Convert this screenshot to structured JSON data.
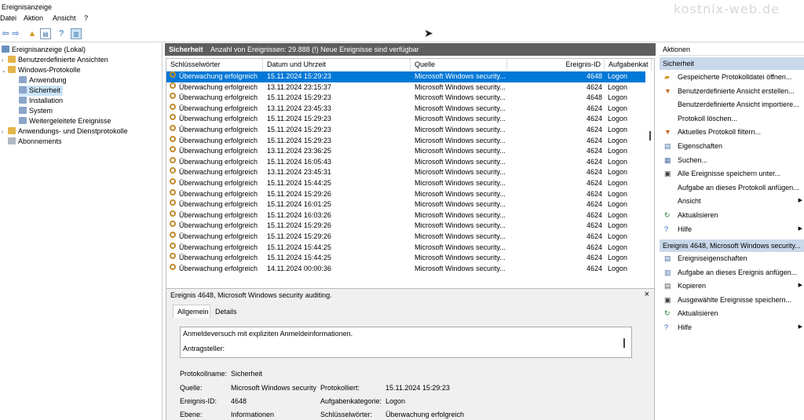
{
  "app": {
    "title": "Ereignisanzeige",
    "watermark": "kostnix-web.de"
  },
  "menu": [
    "Datei",
    "Aktion",
    "Ansicht",
    "?"
  ],
  "tree": {
    "items": [
      {
        "label": "Ereignisanzeige (Lokal)",
        "level": 0
      },
      {
        "label": "Benutzerdefinierte Ansichten",
        "level": 0
      },
      {
        "label": "Windows-Protokolle",
        "level": 0
      },
      {
        "label": "Anwendung",
        "level": 1
      },
      {
        "label": "Sicherheit",
        "level": 1
      },
      {
        "label": "Installation",
        "level": 1
      },
      {
        "label": "System",
        "level": 1
      },
      {
        "label": "Weitergeleitete Ereignisse",
        "level": 1
      },
      {
        "label": "Anwendungs- und Dienstprotokolle",
        "level": 0
      },
      {
        "label": "Abonnements",
        "level": 0
      }
    ]
  },
  "center": {
    "title": "Sicherheit",
    "count": "Anzahl von Ereignissen: 29.888 (!) Neue Ereignisse sind verfügbar"
  },
  "columns": [
    "Schlüsselwörter",
    "Datum und Uhrzeit",
    "Quelle",
    "Ereignis-ID",
    "Aufgabenkat"
  ],
  "rows": [
    [
      "Überwachung erfolgreich",
      "15.11.2024 15:29:23",
      "Microsoft Windows security...",
      "4648",
      "Logon"
    ],
    [
      "Überwachung erfolgreich",
      "13.11.2024 23:15:37",
      "Microsoft Windows security...",
      "4624",
      "Logon"
    ],
    [
      "Überwachung erfolgreich",
      "15.11.2024 15:29:23",
      "Microsoft Windows security...",
      "4648",
      "Logon"
    ],
    [
      "Überwachung erfolgreich",
      "13.11.2024 23:45:33",
      "Microsoft Windows security...",
      "4624",
      "Logon"
    ],
    [
      "Überwachung erfolgreich",
      "15.11.2024 15:29:23",
      "Microsoft Windows security...",
      "4624",
      "Logon"
    ],
    [
      "Überwachung erfolgreich",
      "15.11.2024 15:29:23",
      "Microsoft Windows security...",
      "4624",
      "Logon"
    ],
    [
      "Überwachung erfolgreich",
      "15.11.2024 15:29:23",
      "Microsoft Windows security...",
      "4624",
      "Logon"
    ],
    [
      "Überwachung erfolgreich",
      "13.11.2024 23:36:25",
      "Microsoft Windows security...",
      "4624",
      "Logon"
    ],
    [
      "Überwachung erfolgreich",
      "15.11.2024 16:05:43",
      "Microsoft Windows security...",
      "4624",
      "Logon"
    ],
    [
      "Überwachung erfolgreich",
      "13.11.2024 23:45:31",
      "Microsoft Windows security...",
      "4624",
      "Logon"
    ],
    [
      "Überwachung erfolgreich",
      "15.11.2024 15:44:25",
      "Microsoft Windows security...",
      "4624",
      "Logon"
    ],
    [
      "Überwachung erfolgreich",
      "15.11.2024 15:29:26",
      "Microsoft Windows security...",
      "4624",
      "Logon"
    ],
    [
      "Überwachung erfolgreich",
      "15.11.2024 16:01:25",
      "Microsoft Windows security...",
      "4624",
      "Logon"
    ],
    [
      "Überwachung erfolgreich",
      "15.11.2024 16:03:26",
      "Microsoft Windows security...",
      "4624",
      "Logon"
    ],
    [
      "Überwachung erfolgreich",
      "15.11.2024 15:29:26",
      "Microsoft Windows security...",
      "4624",
      "Logon"
    ],
    [
      "Überwachung erfolgreich",
      "15.11.2024 15:29:26",
      "Microsoft Windows security...",
      "4624",
      "Logon"
    ],
    [
      "Überwachung erfolgreich",
      "15.11.2024 15:44:25",
      "Microsoft Windows security...",
      "4624",
      "Logon"
    ],
    [
      "Überwachung erfolgreich",
      "15.11.2024 15:44:25",
      "Microsoft Windows security...",
      "4624",
      "Logon"
    ],
    [
      "Überwachung erfolgreich",
      "14.11.2024 00:00:36",
      "Microsoft Windows security...",
      "4624",
      "Logon"
    ]
  ],
  "detail": {
    "title": "Ereignis 4648, Microsoft Windows security auditing.",
    "close": "×",
    "tabs": [
      "Allgemein",
      "Details"
    ],
    "desc_line1": "Anmeldeversuch mit expliziten Anmeldeinformationen.",
    "desc_line2": "Antragsteller:",
    "fields": {
      "protokollname_label": "Protokollname:",
      "protokollname": "Sicherheit",
      "quelle_label": "Quelle:",
      "quelle": "Microsoft Windows security",
      "protokolliert_label": "Protokolliert:",
      "protokolliert": "15.11.2024 15:29:23",
      "ereignisid_label": "Ereignis-ID:",
      "ereignisid": "4648",
      "aufgabe_label": "Aufgabenkategorie:",
      "aufgabe": "Logon",
      "ebene_label": "Ebene:",
      "ebene": "Informationen",
      "schluessel_label": "Schlüsselwörter:",
      "schluessel": "Überwachung erfolgreich"
    }
  },
  "actions": {
    "header": "Aktionen",
    "section1": "Sicherheit",
    "items1": [
      {
        "label": "Gespeicherte Protokolldatei öffnen...",
        "icon": "folder-icon",
        "sub": false
      },
      {
        "label": "Benutzerdefinierte Ansicht erstellen...",
        "icon": "filter-icon",
        "sub": false
      },
      {
        "label": "Benutzerdefinierte Ansicht importiere...",
        "icon": "",
        "sub": false
      },
      {
        "label": "Protokoll löschen...",
        "icon": "",
        "sub": false
      },
      {
        "label": "Aktuelles Protokoll filtern...",
        "icon": "filter-icon",
        "sub": false
      },
      {
        "label": "Eigenschaften",
        "icon": "properties-icon",
        "sub": false
      },
      {
        "label": "Suchen...",
        "icon": "find-icon",
        "sub": false
      },
      {
        "label": "Alle Ereignisse speichern unter...",
        "icon": "save-icon",
        "sub": false
      },
      {
        "label": "Aufgabe an dieses Protokoll anfügen...",
        "icon": "",
        "sub": false
      },
      {
        "label": "Ansicht",
        "icon": "",
        "sub": true
      },
      {
        "label": "Aktualisieren",
        "icon": "refresh-icon",
        "sub": false
      },
      {
        "label": "Hilfe",
        "icon": "help-icon",
        "sub": true
      }
    ],
    "section2": "Ereignis 4648, Microsoft Windows security...",
    "items2": [
      {
        "label": "Ereigniseigenschaften",
        "icon": "properties-icon",
        "sub": false
      },
      {
        "label": "Aufgabe an dieses Ereignis anfügen...",
        "icon": "task-icon",
        "sub": false
      },
      {
        "label": "Kopieren",
        "icon": "copy-icon",
        "sub": true
      },
      {
        "label": "Ausgewählte Ereignisse speichern...",
        "icon": "save-icon",
        "sub": false
      },
      {
        "label": "Aktualisieren",
        "icon": "refresh-icon",
        "sub": false
      },
      {
        "label": "Hilfe",
        "icon": "help-icon",
        "sub": true
      }
    ]
  }
}
